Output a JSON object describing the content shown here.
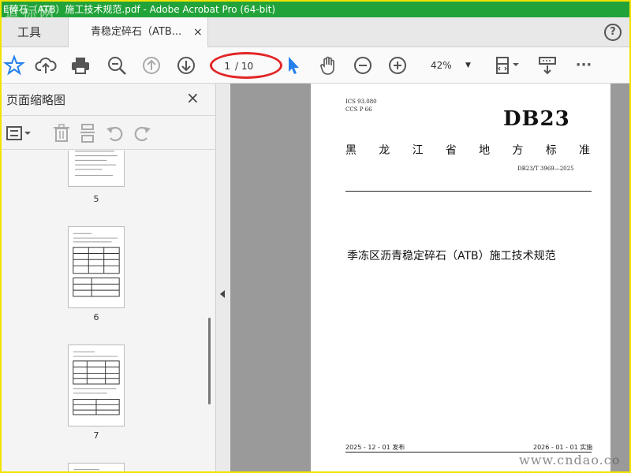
{
  "window": {
    "title": "E碎石（ATB）施工技术规范.pdf - Adobe Acrobat Pro (64-bit)",
    "watermark_top": "道标网",
    "watermark_bottom": "www.cndao.co"
  },
  "tabs": {
    "tools_label": "工具",
    "doc_label": "青稳定碎石（ATB...",
    "close_glyph": "×",
    "help_glyph": "?"
  },
  "toolbar": {
    "page_current": "1",
    "page_total": "/ 10",
    "zoom": "42%",
    "more_glyph": "···"
  },
  "sidebar": {
    "title": "页面缩略图",
    "close_glyph": "×",
    "thumbnails": [
      {
        "label": "5"
      },
      {
        "label": "6"
      },
      {
        "label": "7"
      }
    ]
  },
  "document": {
    "ics": "ICS  93.080",
    "ccs": "CCS  P  66",
    "db_code": "DB23",
    "region_title": [
      "黑",
      "龙",
      "江",
      "省",
      "地",
      "方",
      "标",
      "准"
    ],
    "std_number": "DB23/T 3969—2025",
    "main_title": "季冻区沥青稳定碎石（ATB）施工技术规范",
    "publish_date": "2025 - 12 - 01 发布",
    "implement_date": "2026 - 01 - 01 实施"
  },
  "colors": {
    "titlebar": "#22a33a",
    "frame": "#f2e200",
    "accent_blue": "#2680eb",
    "highlight_red": "#e32626"
  }
}
